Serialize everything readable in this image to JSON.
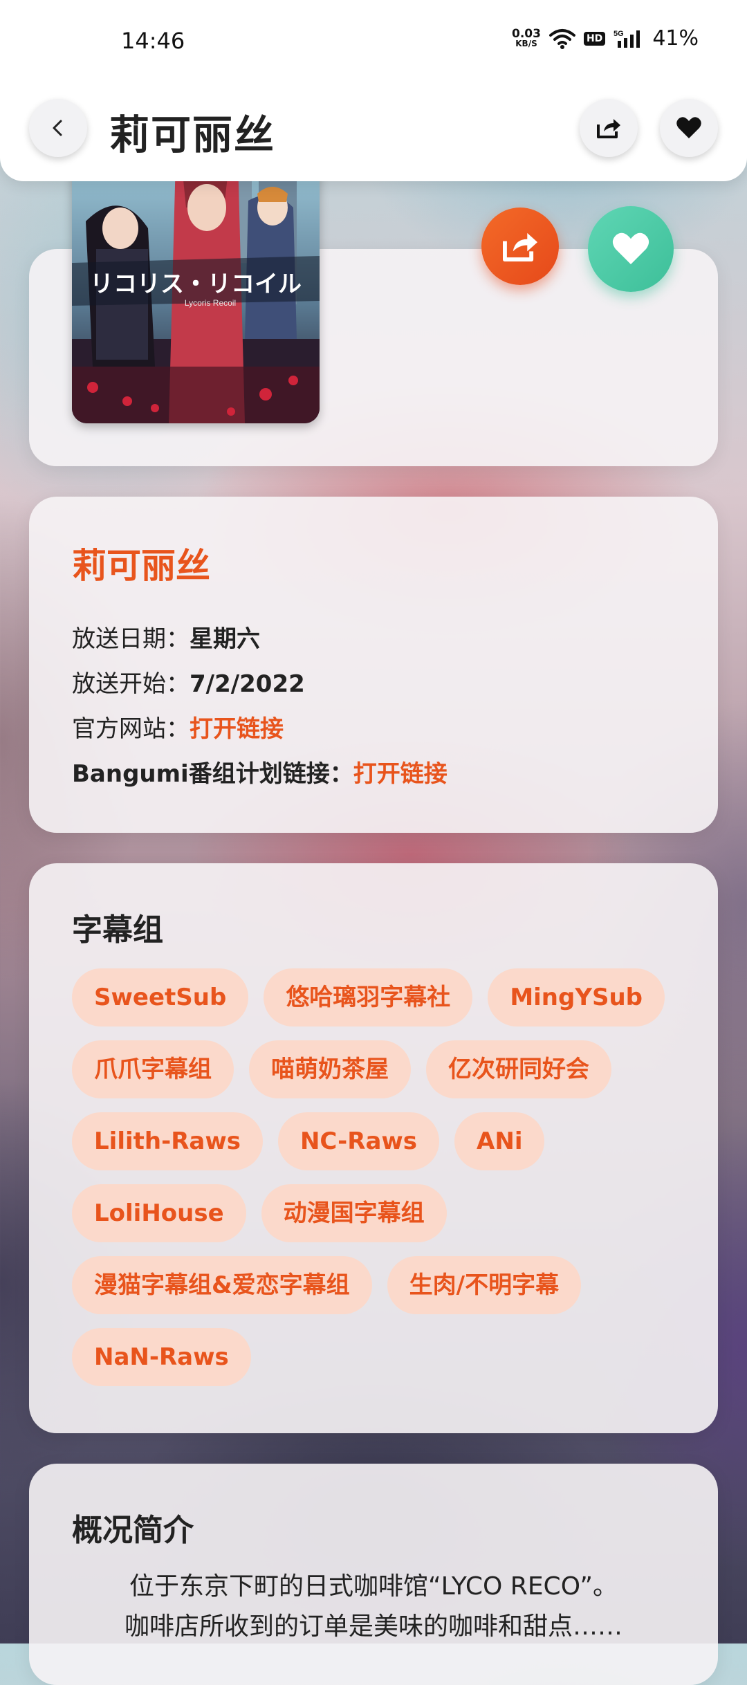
{
  "status_bar": {
    "time": "14:46",
    "net_speed_value": "0.03",
    "net_speed_unit": "KB/S",
    "hd_label": "HD",
    "signal_label": "5G",
    "battery": "41%"
  },
  "header": {
    "title": "莉可丽丝",
    "back_icon": "chevron-left-icon",
    "share_icon": "share-icon",
    "favorite_icon": "heart-icon"
  },
  "cover": {
    "overlay_text": "リコリス・リコイル",
    "overlay_subtext": "Lycoris Recoil",
    "share_color": "#ee5a1e",
    "favorite_color": "#4cc9a5"
  },
  "info": {
    "title": "莉可丽丝",
    "broadcast_day_label": "放送日期：",
    "broadcast_day_value": "星期六",
    "broadcast_start_label": "放送开始：",
    "broadcast_start_value": "7/2/2022",
    "official_site_label": "官方网站：",
    "official_site_link": "打开链接",
    "bangumi_label": "Bangumi番组计划链接：",
    "bangumi_link": "打开链接"
  },
  "subtitle_groups": {
    "title": "字幕组",
    "items": [
      "SweetSub",
      "悠哈璃羽字幕社",
      "MingYSub",
      "爪爪字幕组",
      "喵萌奶茶屋",
      "亿次研同好会",
      "Lilith-Raws",
      "NC-Raws",
      "ANi",
      "LoliHouse",
      "动漫国字幕组",
      "漫猫字幕组&爱恋字幕组",
      "生肉/不明字幕",
      "NaN-Raws"
    ]
  },
  "summary": {
    "title": "概况简介",
    "line1": "位于东京下町的日式咖啡馆“LYCO RECO”。",
    "line2": "咖啡店所收到的订单是美味的咖啡和甜点……"
  },
  "colors": {
    "accent": "#e8541c",
    "chip_bg": "#fbd9cb"
  }
}
